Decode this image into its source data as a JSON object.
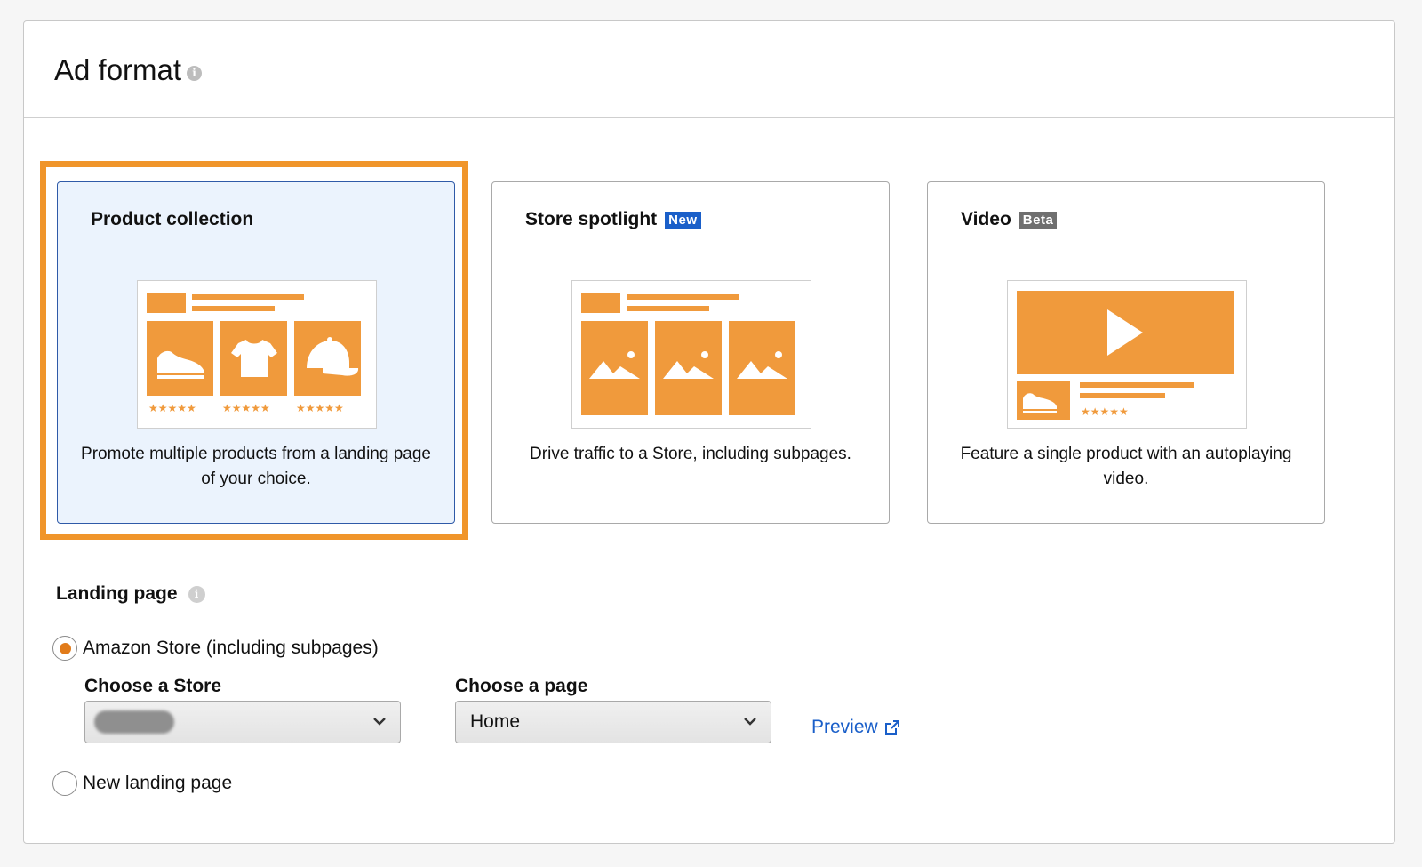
{
  "header": {
    "title": "Ad format"
  },
  "formats": [
    {
      "title": "Product collection",
      "tag": "",
      "description": "Promote multiple products from a landing page of your choice.",
      "selected": true
    },
    {
      "title": "Store spotlight",
      "tag": "New",
      "description": "Drive traffic to a Store, including subpages.",
      "selected": false
    },
    {
      "title": "Video",
      "tag": "Beta",
      "description": "Feature a single product with an autoplaying video.",
      "selected": false
    }
  ],
  "landing": {
    "label": "Landing page",
    "option_store": "Amazon Store (including subpages)",
    "option_new": "New landing page",
    "selected_option": "Amazon Store (including subpages)",
    "store_label": "Choose a Store",
    "page_label": "Choose a page",
    "page_value": "Home",
    "preview_label": "Preview"
  },
  "colors": {
    "accent": "#f0952a",
    "radio": "#e17b1a",
    "link": "#1a5fc9",
    "selected_bg": "#ebf3fd",
    "selected_border": "#2f5aa8"
  },
  "icons": [
    "info-icon",
    "shoe-icon",
    "tshirt-icon",
    "cap-icon",
    "star-icon",
    "image-icon",
    "play-icon",
    "chevron-down-icon",
    "external-link-icon"
  ]
}
